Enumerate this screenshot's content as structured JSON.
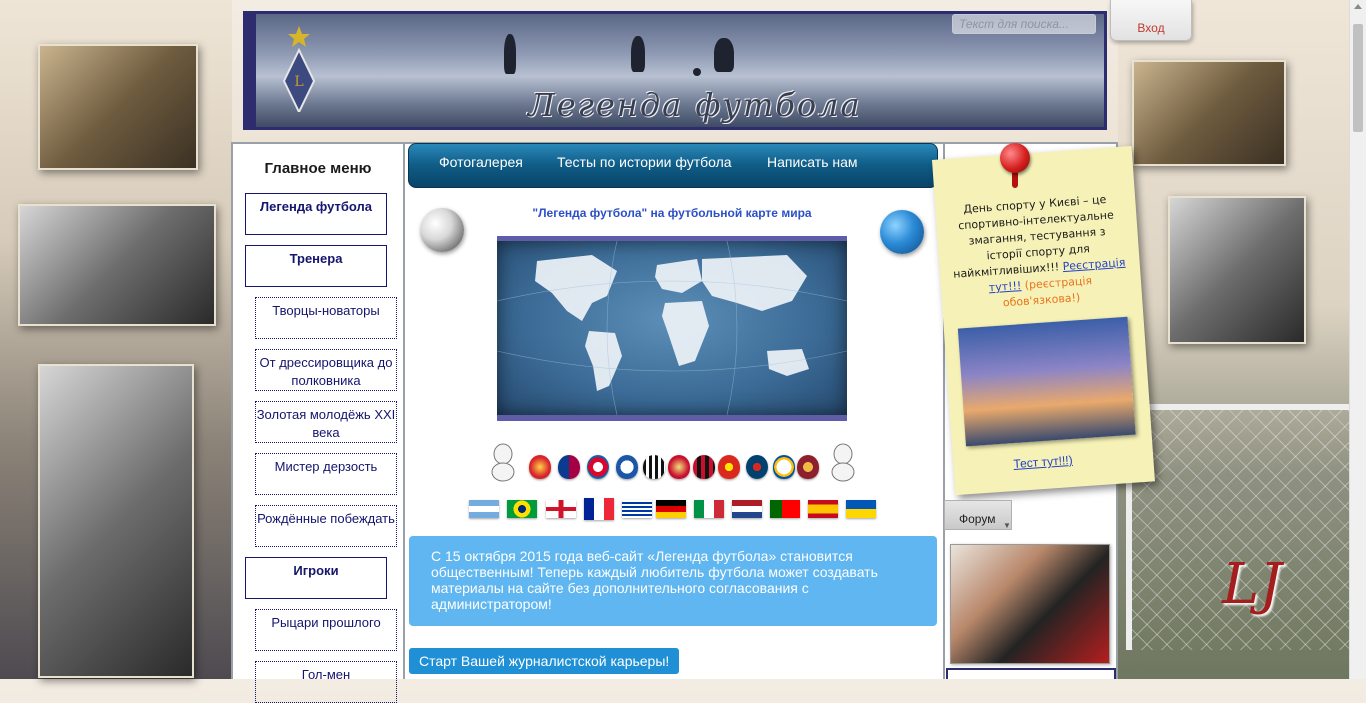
{
  "header": {
    "banner_title": "Легенда футбола",
    "search_placeholder": "Текст для поиска...",
    "login_label": "Вход"
  },
  "sidebar": {
    "title": "Главное меню",
    "items": [
      {
        "label": "Легенда футбола",
        "level": "head"
      },
      {
        "label": "Тренера",
        "level": "head"
      },
      {
        "label": "Творцы-новаторы",
        "level": "sub"
      },
      {
        "label": "От дрессировщика до полковника",
        "level": "sub"
      },
      {
        "label": "Золотая молодёжь XXI века",
        "level": "sub"
      },
      {
        "label": "Мистер дерзость",
        "level": "sub"
      },
      {
        "label": "Рождённые побеждать",
        "level": "sub"
      },
      {
        "label": "Игроки",
        "level": "head"
      },
      {
        "label": "Рыцари прошлого",
        "level": "sub"
      },
      {
        "label": "Гол-мен",
        "level": "sub"
      }
    ]
  },
  "nav": {
    "items": [
      "Фотогалерея",
      "Тесты по истории футбола",
      "Написать нам"
    ]
  },
  "main": {
    "map_title": "\"Легенда футбола\" на футбольной карте мира",
    "notice": "С 15 октября 2015 года веб-сайт «Легенда футбола» становится общественным! Теперь каждый любитель футбола может создавать материалы на сайте без дополнительного согласования с администратором!",
    "cta_label": "Старт Вашей журналистской карьеры!"
  },
  "sticky": {
    "text": "День спорту у Києві – це спортивно-інтелектуальне змагання, тестування з історії спорту для найкмітливіших!!!",
    "link": "Реєстрація тут!!!",
    "note": "(реєстрація обов'язкова!)",
    "test_link": "Тест тут!!!)"
  },
  "right": {
    "forum_label": "Форум"
  },
  "colors": {
    "nav_dark": "#0f5c86",
    "notice_bg": "#5fb6f0",
    "menu_text": "#15156e",
    "map_title": "#2b50c8",
    "login_text": "#c0392b"
  }
}
